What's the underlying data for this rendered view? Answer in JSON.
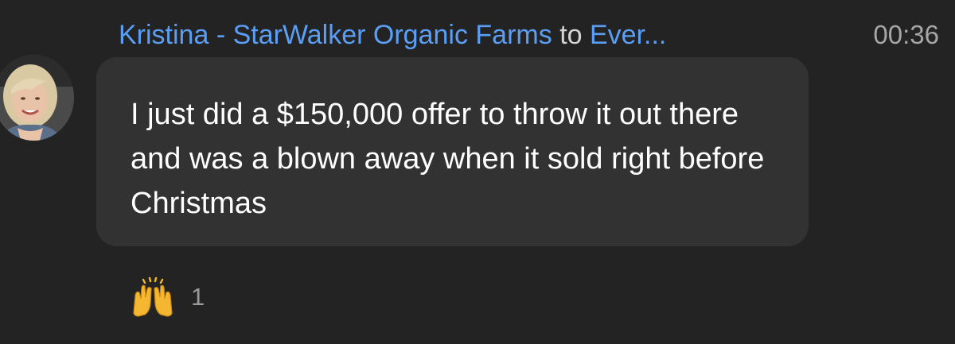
{
  "message": {
    "sender": "Kristina - StarWalker Organic Farms",
    "to_word": "to",
    "recipient": "Ever...",
    "timestamp": "00:36",
    "text": "I just did a $150,000 offer to throw it out there and was a blown away when it sold right before Christmas",
    "avatar_icon": "user-avatar-photo",
    "reaction": {
      "emoji_icon": "raising-hands-emoji",
      "count": "1"
    }
  },
  "colors": {
    "background": "#232323",
    "bubble": "#323232",
    "link_blue": "#5b9ef5",
    "timestamp": "#a6a6a6"
  }
}
